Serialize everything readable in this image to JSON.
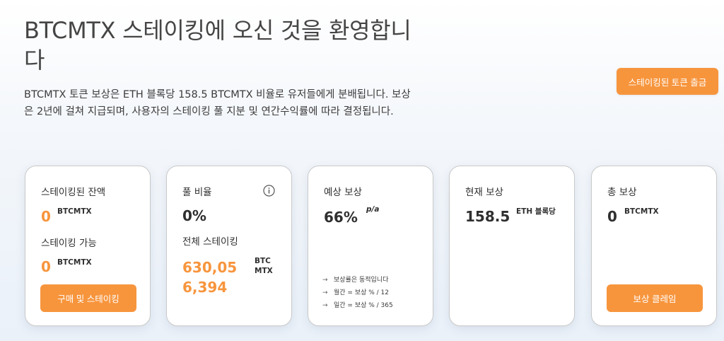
{
  "header": {
    "title": "BTCMTX 스테이킹에 오신 것을 환영합니다",
    "intro": "BTCMTX 토큰 보상은 ETH 블록당 158.5 BTCMTX 비율로 유저들에게 분배됩니다. 보상은 2년에 걸쳐 지급되며, 사용자의 스테이킹 풀 지분 및 연간수익률에 따라 결정됩니다.",
    "withdraw_button": "스테이킹된 토큰 출금"
  },
  "cards": {
    "staked": {
      "label": "스테이킹된 잔액",
      "value": "0",
      "unit": "BTCMTX",
      "available_label": "스테이킹 가능",
      "available_value": "0",
      "available_unit": "BTCMTX",
      "button": "구매 및 스테이킹"
    },
    "pool": {
      "label": "풀 비율",
      "value": "0%",
      "total_label": "전체 스테이킹",
      "total_value_line1": "630,05",
      "total_value_line2": "6,394",
      "unit_line1": "BTC",
      "unit_line2": "MTX",
      "info_icon": "info-icon"
    },
    "expected": {
      "label": "예상 보상",
      "value": "66%",
      "suffix": "p/a",
      "notes": [
        "보상률은 동적입니다",
        "월간 = 보상 % / 12",
        "일간 = 보상 % / 365"
      ],
      "note_icon": "arrow-right-icon"
    },
    "current": {
      "label": "현재 보상",
      "value": "158.5",
      "unit": "ETH 블록당"
    },
    "total": {
      "label": "총 보상",
      "value": "0",
      "unit": "BTCMTX",
      "button": "보상 클레임"
    }
  },
  "colors": {
    "accent": "#f7953d",
    "text": "#2f2f2f",
    "card_border": "#c9c9c9"
  }
}
